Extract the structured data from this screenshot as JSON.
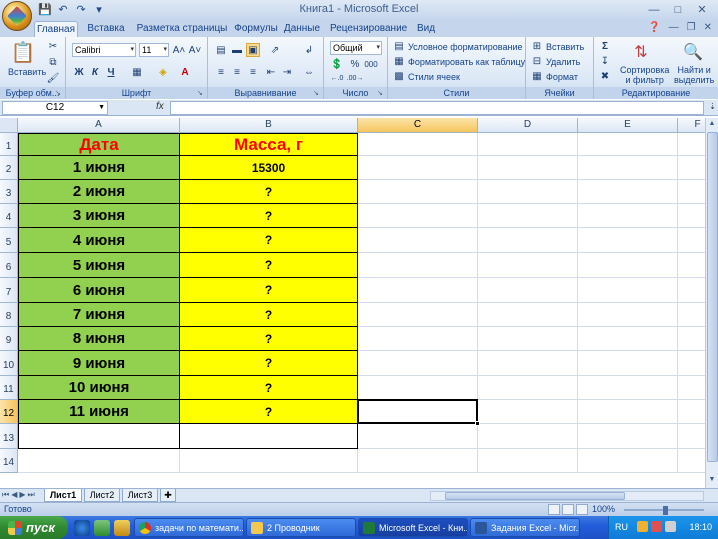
{
  "window": {
    "title": "Книга1 - Microsoft Excel"
  },
  "ribbon": {
    "tabs": [
      "Главная",
      "Вставка",
      "Разметка страницы",
      "Формулы",
      "Данные",
      "Рецензирование",
      "Вид"
    ],
    "active_tab": "Главная",
    "clipboard": {
      "paste_label": "Вставить",
      "group_label": "Буфер обм..."
    },
    "font": {
      "name": "Calibri",
      "size": "11",
      "bold": "Ж",
      "italic": "К",
      "underline": "Ч",
      "group_label": "Шрифт"
    },
    "alignment": {
      "group_label": "Выравнивание"
    },
    "number": {
      "format": "Общий",
      "percent": "%",
      "thousands": "000",
      "group_label": "Число"
    },
    "styles": {
      "conditional": "Условное форматирование",
      "format_table": "Форматировать как таблицу",
      "cell_styles": "Стили ячеек",
      "group_label": "Стили"
    },
    "cells": {
      "insert": "Вставить",
      "delete": "Удалить",
      "format": "Формат",
      "group_label": "Ячейки"
    },
    "editing": {
      "sum": "Σ",
      "sort_line1": "Сортировка",
      "sort_line2": "и фильтр",
      "find_line1": "Найти и",
      "find_line2": "выделить",
      "group_label": "Редактирование"
    }
  },
  "formula_bar": {
    "name_box": "C12",
    "fx": "fx",
    "value": ""
  },
  "sheet": {
    "columns": [
      "A",
      "B",
      "C",
      "D",
      "E",
      "F"
    ],
    "rows": [
      "1",
      "2",
      "3",
      "4",
      "5",
      "6",
      "7",
      "8",
      "9",
      "10",
      "11",
      "12",
      "13",
      "14"
    ],
    "header": {
      "date": "Дата",
      "mass": "Масса, г"
    },
    "table": [
      {
        "date": "1 июня",
        "mass": "15300"
      },
      {
        "date": "2 июня",
        "mass": "?"
      },
      {
        "date": "3 июня",
        "mass": "?"
      },
      {
        "date": "4 июня",
        "mass": "?"
      },
      {
        "date": "5 июня",
        "mass": "?"
      },
      {
        "date": "6 июня",
        "mass": "?"
      },
      {
        "date": "7 июня",
        "mass": "?"
      },
      {
        "date": "8 июня",
        "mass": "?"
      },
      {
        "date": "9 июня",
        "mass": "?"
      },
      {
        "date": "10 июня",
        "mass": "?"
      },
      {
        "date": "11 июня",
        "mass": "?"
      }
    ],
    "selected_cell": "C12",
    "colors": {
      "date_fill": "#92d050",
      "mass_fill": "#ffff00",
      "header_text": "#ff0000"
    }
  },
  "sheet_tabs": [
    "Лист1",
    "Лист2",
    "Лист3"
  ],
  "active_sheet": "Лист1",
  "status": {
    "text": "Готово",
    "zoom": "100%"
  },
  "taskbar": {
    "start": "пуск",
    "buttons": [
      {
        "label": "задачи по математи..."
      },
      {
        "label": "2 Проводник"
      },
      {
        "label": "Microsoft Excel - Кни..."
      },
      {
        "label": "Задания Excel - Micr..."
      }
    ],
    "active_button": "Microsoft Excel - Кни...",
    "lang": "RU",
    "clock": "18:10"
  }
}
